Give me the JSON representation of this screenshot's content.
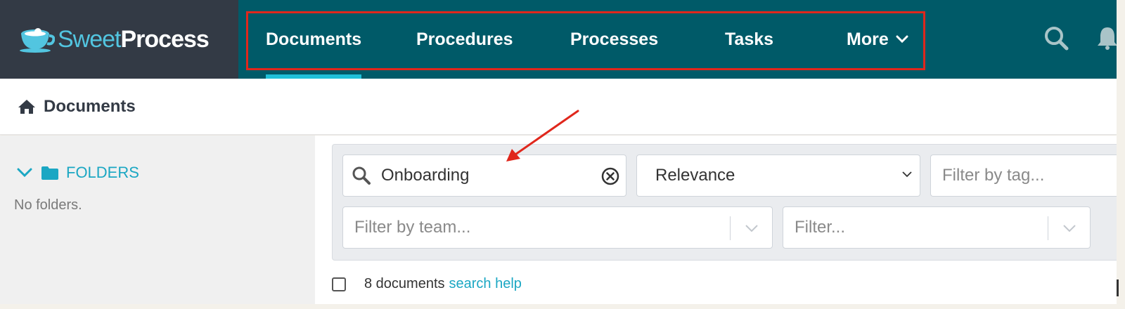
{
  "app": {
    "logo_word1": "Sweet",
    "logo_word2": "Process"
  },
  "nav": {
    "items": [
      {
        "label": "Documents",
        "active": true
      },
      {
        "label": "Procedures"
      },
      {
        "label": "Processes"
      },
      {
        "label": "Tasks"
      },
      {
        "label": "More"
      }
    ],
    "icons": [
      "search-icon",
      "bell-icon"
    ]
  },
  "breadcrumb": {
    "icon": "home-icon",
    "title": "Documents"
  },
  "sidebar": {
    "folders_label": "FOLDERS",
    "empty_text": "No folders."
  },
  "filters": {
    "search_value": "Onboarding",
    "sort_value": "Relevance",
    "tag_placeholder": "Filter by tag...",
    "team_placeholder": "Filter by team...",
    "filter_placeholder": "Filter..."
  },
  "results": {
    "count_text": "8 documents",
    "help_link": "search help"
  },
  "colors": {
    "topbar": "#005a68",
    "logo_bg": "#333a45",
    "accent": "#1ba7c3",
    "annotation_red": "#e0271c"
  }
}
